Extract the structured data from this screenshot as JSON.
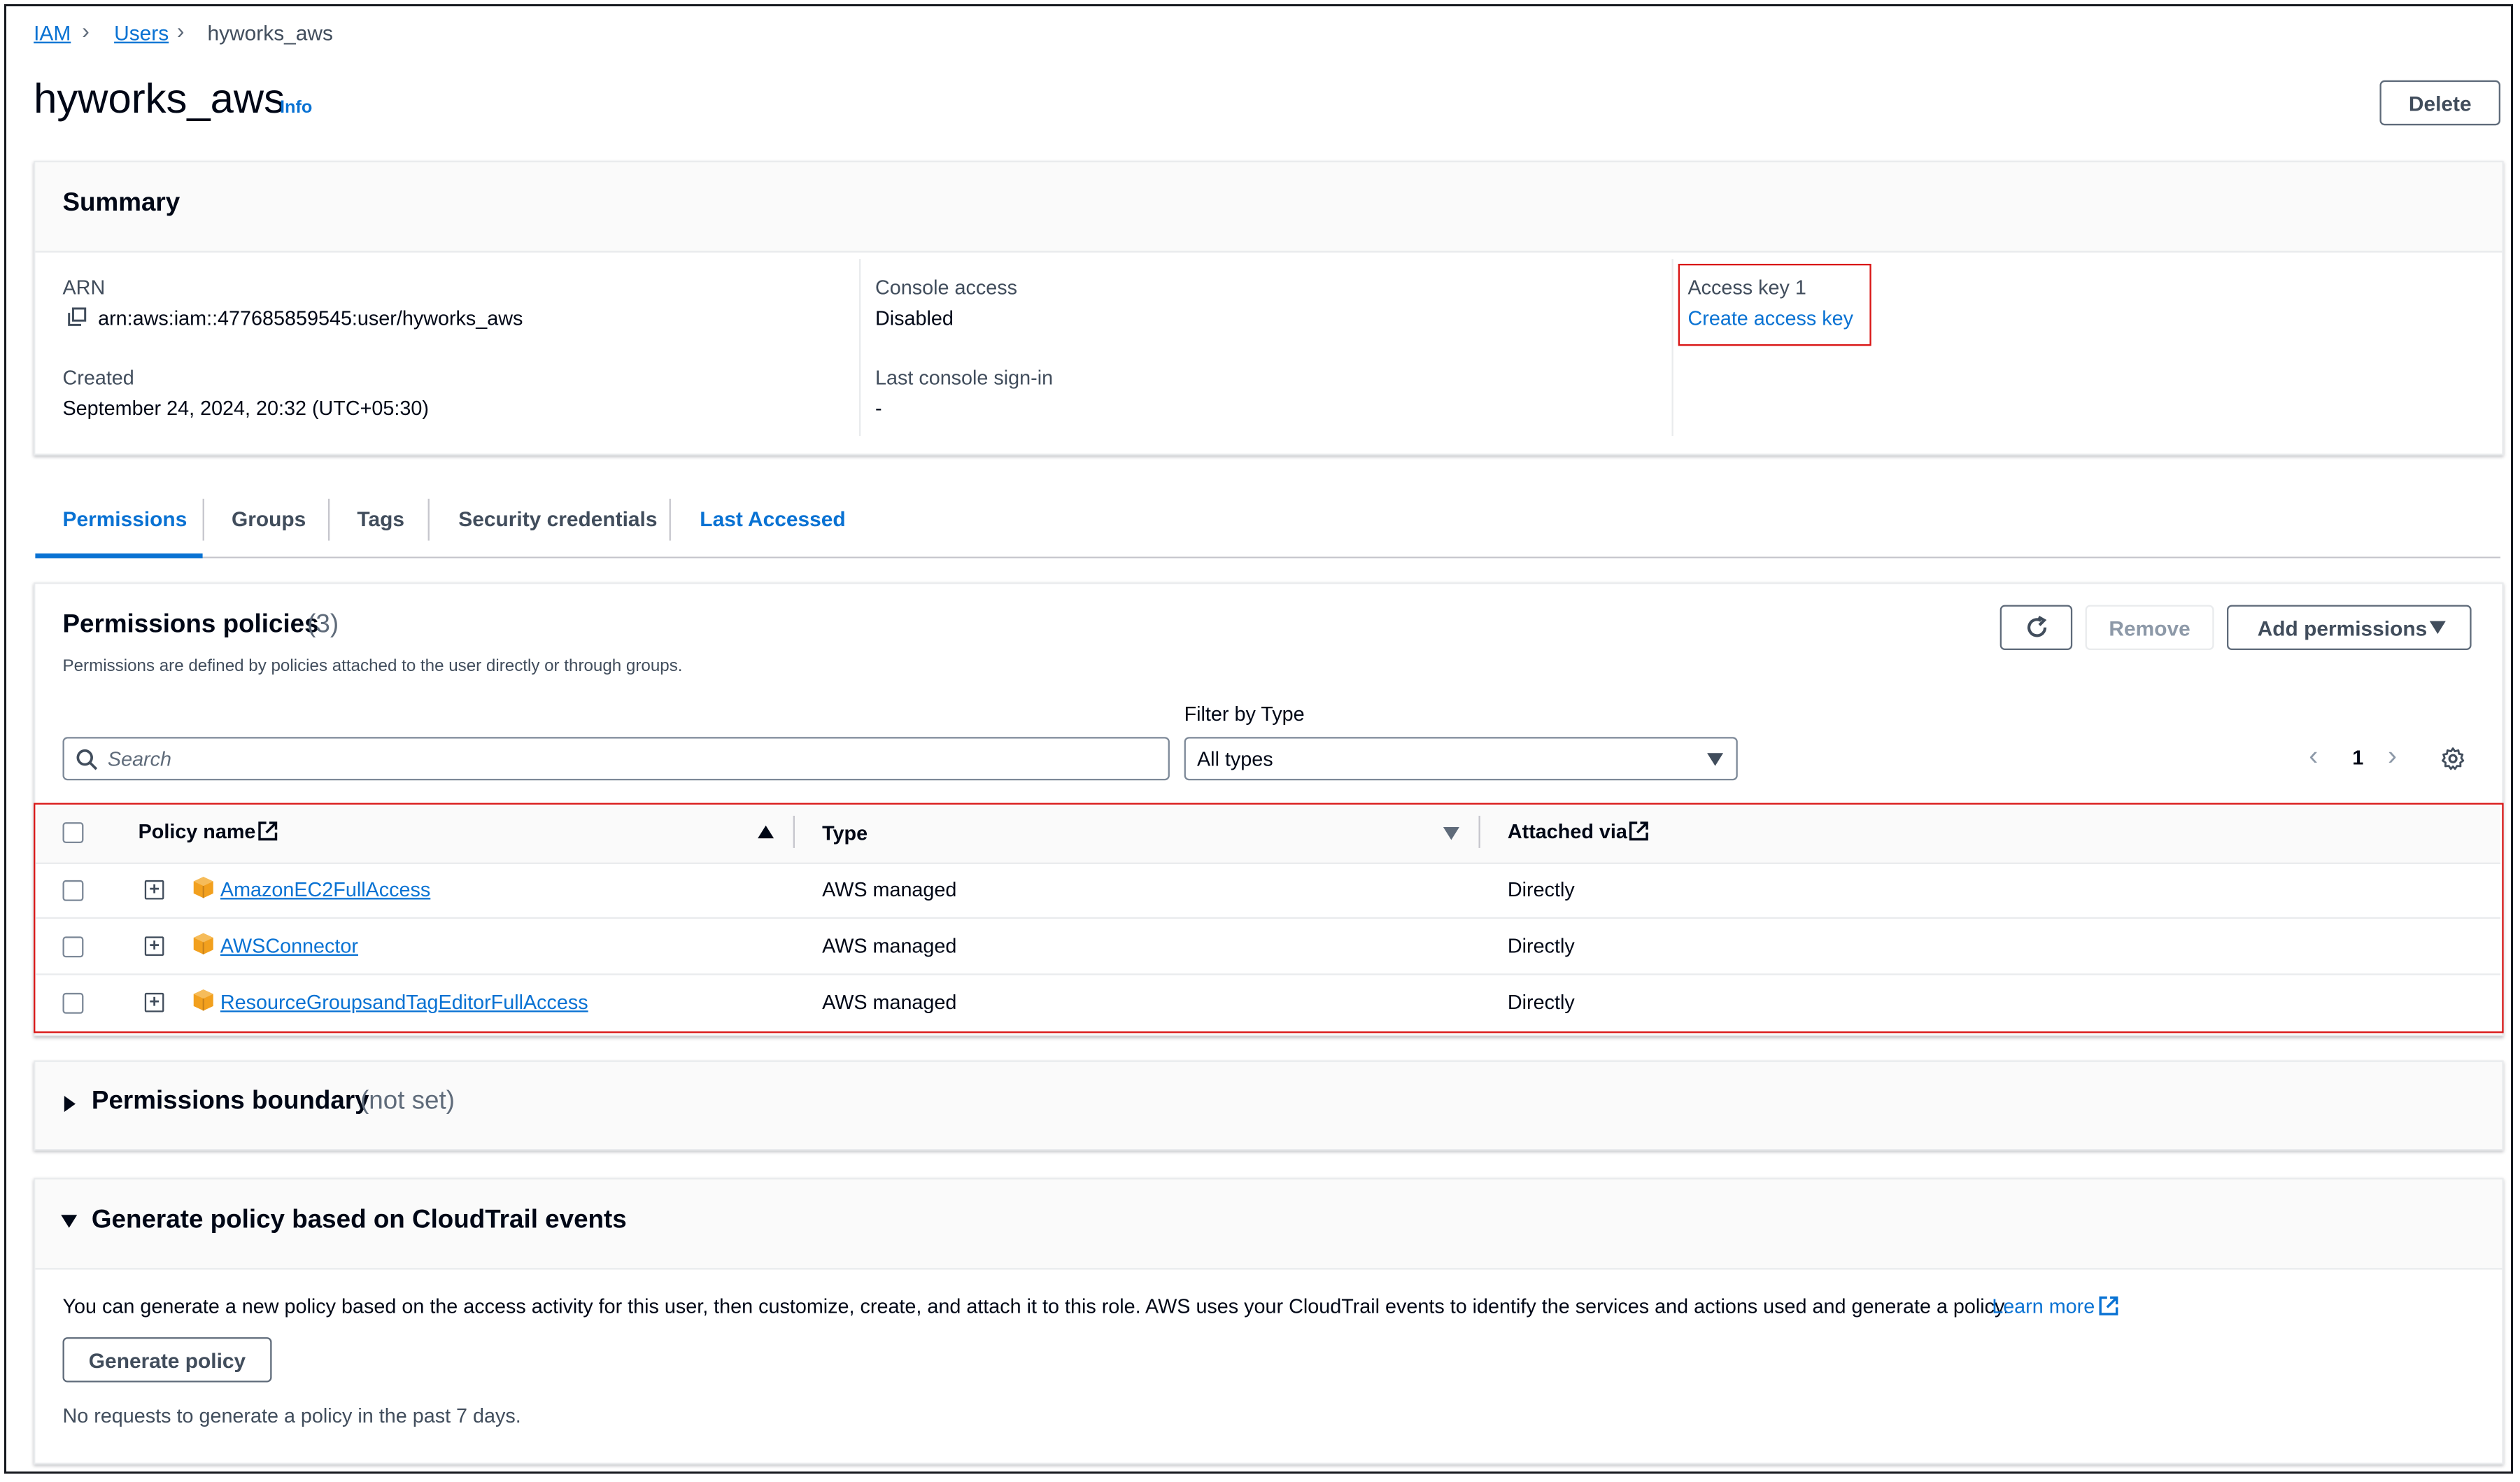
{
  "breadcrumb": {
    "items": [
      "IAM",
      "Users",
      "hyworks_aws"
    ]
  },
  "header": {
    "title": "hyworks_aws",
    "info": "Info",
    "delete": "Delete"
  },
  "summary": {
    "title": "Summary",
    "arn_label": "ARN",
    "arn_value": "arn:aws:iam::477685859545:user/hyworks_aws",
    "created_label": "Created",
    "created_value": "September 24, 2024, 20:32 (UTC+05:30)",
    "console_label": "Console access",
    "console_value": "Disabled",
    "signin_label": "Last console sign-in",
    "signin_value": "-",
    "key_label": "Access key 1",
    "key_link": "Create access key"
  },
  "tabs": [
    {
      "label": "Permissions",
      "active": true
    },
    {
      "label": "Groups"
    },
    {
      "label": "Tags"
    },
    {
      "label": "Security credentials"
    },
    {
      "label": "Last Accessed",
      "active": true
    }
  ],
  "permissions": {
    "title": "Permissions policies",
    "count": "(3)",
    "description": "Permissions are defined by policies attached to the user directly or through groups.",
    "remove": "Remove",
    "add": "Add permissions",
    "filter_label": "Filter by Type",
    "search_placeholder": "Search",
    "filter_value": "All types",
    "page": "1",
    "columns": [
      "Policy name",
      "Type",
      "Attached via"
    ],
    "rows": [
      {
        "name": "AmazonEC2FullAccess",
        "type": "AWS managed",
        "via": "Directly"
      },
      {
        "name": "AWSConnector",
        "type": "AWS managed",
        "via": "Directly"
      },
      {
        "name": "ResourceGroupsandTagEditorFullAccess",
        "type": "AWS managed",
        "via": "Directly"
      }
    ]
  },
  "boundary": {
    "title": "Permissions boundary",
    "status": "(not set)"
  },
  "cloudtrail": {
    "title": "Generate policy based on CloudTrail events",
    "description": "You can generate a new policy based on the access activity for this user, then customize, create, and attach it to this role. AWS uses your CloudTrail events to identify the services and actions used and generate a policy.",
    "learn_more": "Learn more",
    "button": "Generate policy",
    "note": "No requests to generate a policy in the past 7 days."
  },
  "colors": {
    "link": "#0972d3",
    "highlight": "#d91515",
    "policy_icon": "#f2a01e"
  },
  "icons": [
    "copy-icon",
    "search-icon",
    "refresh-icon",
    "gear-icon",
    "external-link-icon",
    "package-icon"
  ]
}
